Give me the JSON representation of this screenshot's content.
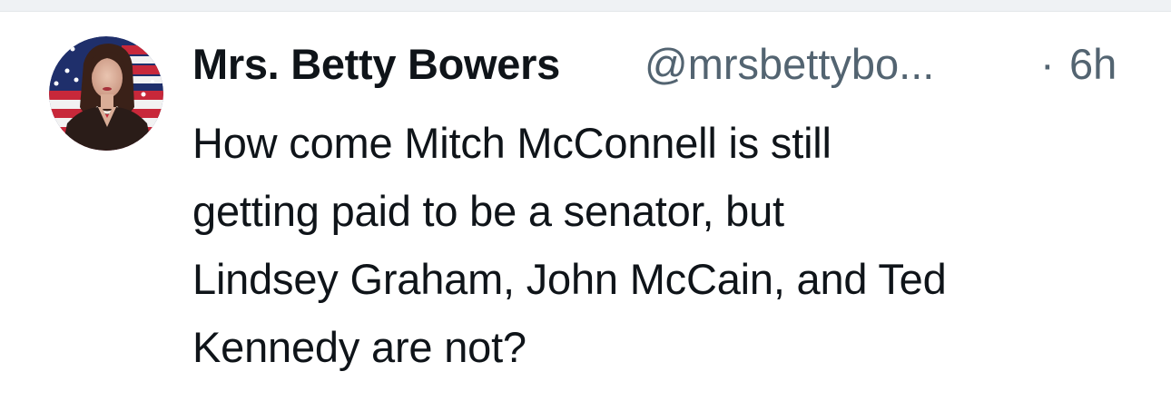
{
  "tweet": {
    "author": {
      "display_name": "Mrs. Betty Bowers",
      "handle": "@mrsbettybo...",
      "avatar_icon": "profile-photo"
    },
    "separator": "·",
    "time": "6h",
    "text_lines": [
      "How come Mitch McConnell is still",
      "getting paid to be a senator, but",
      "Lindsey Graham, John McCain, and Ted",
      "Kennedy are not?"
    ]
  },
  "colors": {
    "text_primary": "#0f1419",
    "text_secondary": "#536471",
    "divider": "#eff2f4"
  }
}
